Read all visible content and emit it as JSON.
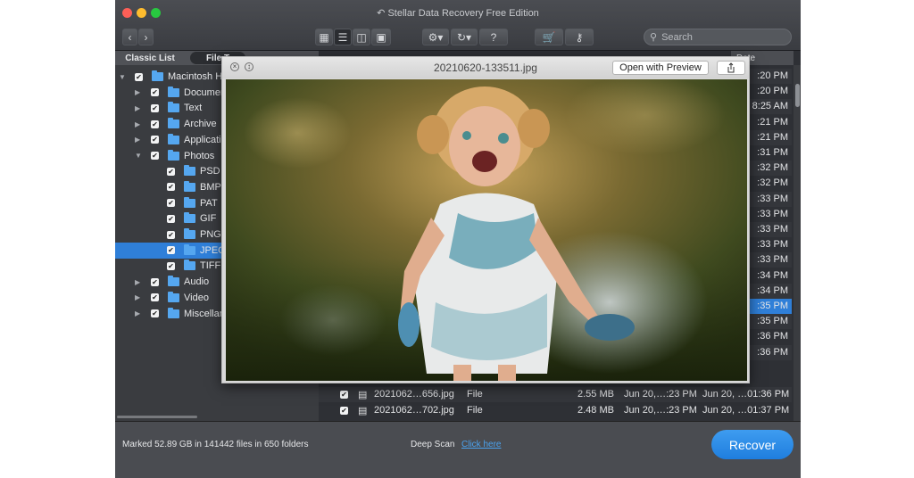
{
  "app": {
    "title": "Stellar Data Recovery Free Edition"
  },
  "toolbar": {
    "search_placeholder": "Search",
    "help_label": "?"
  },
  "tabs": {
    "classic": "Classic List",
    "file": "File T"
  },
  "tree": [
    {
      "label": "Macintosh H",
      "indent": 0,
      "expanded": true,
      "checked": true,
      "selected": false
    },
    {
      "label": "Documen",
      "indent": 1,
      "expanded": false,
      "checked": true,
      "selected": false
    },
    {
      "label": "Text",
      "indent": 1,
      "expanded": false,
      "checked": true,
      "selected": false
    },
    {
      "label": "Archive",
      "indent": 1,
      "expanded": false,
      "checked": true,
      "selected": false
    },
    {
      "label": "Applicatio",
      "indent": 1,
      "expanded": false,
      "checked": true,
      "selected": false
    },
    {
      "label": "Photos",
      "indent": 1,
      "expanded": true,
      "checked": true,
      "selected": false
    },
    {
      "label": "PSD",
      "indent": 2,
      "checked": true,
      "selected": false
    },
    {
      "label": "BMP",
      "indent": 2,
      "checked": true,
      "selected": false
    },
    {
      "label": "PAT",
      "indent": 2,
      "checked": true,
      "selected": false
    },
    {
      "label": "GIF",
      "indent": 2,
      "checked": true,
      "selected": false
    },
    {
      "label": "PNG",
      "indent": 2,
      "checked": true,
      "selected": false
    },
    {
      "label": "JPEG",
      "indent": 2,
      "checked": true,
      "selected": true
    },
    {
      "label": "TIFF",
      "indent": 2,
      "checked": true,
      "selected": false
    },
    {
      "label": "Audio",
      "indent": 1,
      "expanded": false,
      "checked": true,
      "selected": false
    },
    {
      "label": "Video",
      "indent": 1,
      "expanded": false,
      "checked": true,
      "selected": false
    },
    {
      "label": "Miscellan",
      "indent": 1,
      "expanded": false,
      "checked": true,
      "selected": false
    }
  ],
  "list": {
    "date_header": "Date",
    "dates": [
      ":20 PM",
      ":20 PM",
      "8:25 AM",
      ":21 PM",
      ":21 PM",
      ":31 PM",
      ":32 PM",
      ":32 PM",
      ":33 PM",
      ":33 PM",
      ":33 PM",
      ":33 PM",
      ":33 PM",
      ":34 PM",
      ":34 PM",
      ":35 PM",
      ":35 PM",
      ":36 PM",
      ":36 PM"
    ],
    "selected_index": 15,
    "rows": [
      {
        "name": "2021062…656.jpg",
        "kind": "File",
        "size": "2.55 MB",
        "created": "Jun 20,…:23 PM",
        "modified": "Jun 20, …01:36 PM"
      },
      {
        "name": "2021062…702.jpg",
        "kind": "File",
        "size": "2.48 MB",
        "created": "Jun 20,…:23 PM",
        "modified": "Jun 20, …01:37 PM"
      }
    ]
  },
  "status": {
    "marked": "Marked 52.89 GB in 141442 files in 650 folders",
    "deep_scan": "Deep Scan",
    "click_here": "Click here",
    "recover": "Recover"
  },
  "preview": {
    "filename": "20210620-133511.jpg",
    "open_with": "Open with Preview"
  }
}
